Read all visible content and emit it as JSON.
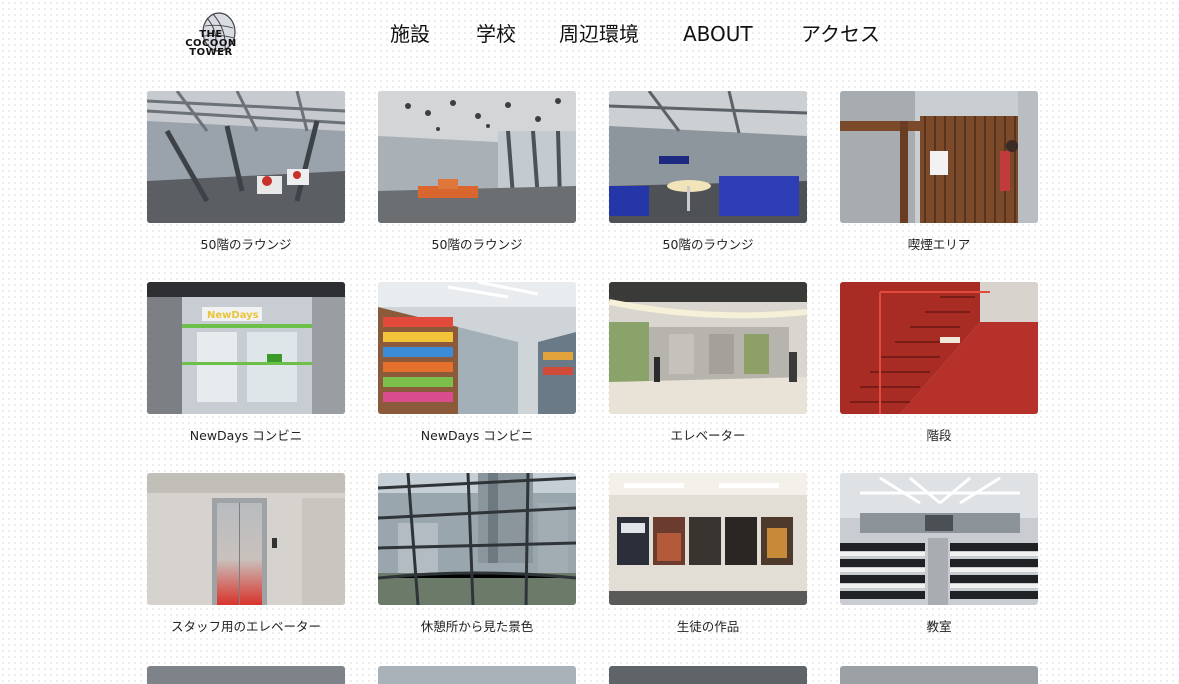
{
  "header": {
    "logo": {
      "line1": "THE",
      "line2": "COCOON",
      "line3": "TOWER"
    },
    "nav": [
      {
        "label": "施設"
      },
      {
        "label": "学校"
      },
      {
        "label": "周辺環境"
      },
      {
        "label": "ABOUT"
      },
      {
        "label": "アクセス"
      }
    ]
  },
  "gallery": {
    "items": [
      {
        "caption": "50階のラウンジ",
        "image": "lounge-photo"
      },
      {
        "caption": "50階のラウンジ",
        "image": "lounge-photo"
      },
      {
        "caption": "50階のラウンジ",
        "image": "lounge-photo"
      },
      {
        "caption": "喫煙エリア",
        "image": "smoking-area-photo"
      },
      {
        "caption": "NewDays コンビニ",
        "image": "convenience-store-photo"
      },
      {
        "caption": "NewDays コンビニ",
        "image": "store-shelves-photo"
      },
      {
        "caption": "エレベーター",
        "image": "elevator-hall-photo"
      },
      {
        "caption": "階段",
        "image": "red-stairs-photo"
      },
      {
        "caption": "スタッフ用のエレベーター",
        "image": "staff-elevator-photo"
      },
      {
        "caption": "休憩所から見た景色",
        "image": "city-view-photo"
      },
      {
        "caption": "生徒の作品",
        "image": "posters-photo"
      },
      {
        "caption": "教室",
        "image": "classroom-photo"
      }
    ]
  },
  "colors": {
    "text": "#222222",
    "background": "#ffffff",
    "dot": "#e6e6e6",
    "stairs_red": "#c8312a"
  }
}
